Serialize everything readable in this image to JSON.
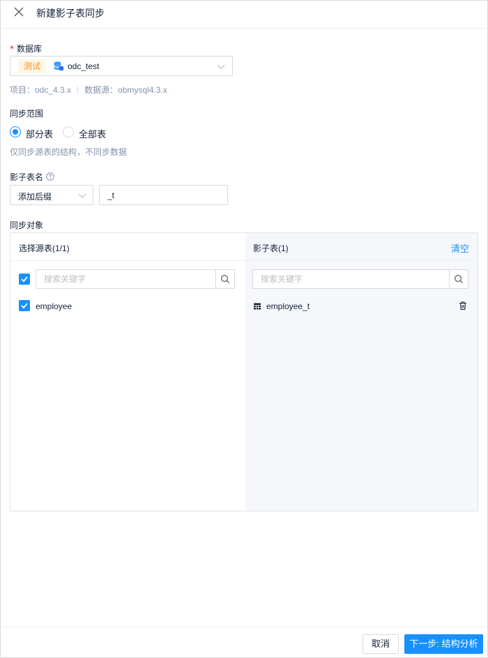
{
  "header": {
    "title": "新建影子表同步",
    "close_icon": "close-icon"
  },
  "database": {
    "required_mark": "*",
    "label": "数据库",
    "env_tag": "测试",
    "db_name": "odc_test",
    "project_text": "项目：odc_4.3.x",
    "datasource_text": "数据源：obmysql4.3.x"
  },
  "sync_scope": {
    "label": "同步范围",
    "options": [
      {
        "label": "部分表",
        "checked": true
      },
      {
        "label": "全部表",
        "checked": false
      }
    ],
    "help": "仅同步源表的结构，不同步数据"
  },
  "shadow_name": {
    "label": "影子表名",
    "mode_value": "添加后缀",
    "suffix_value": "_t"
  },
  "sync_objects": {
    "label": "同步对象",
    "source": {
      "title": "选择源表(1/1)",
      "search_placeholder": "搜索关键字",
      "items": [
        {
          "name": "employee",
          "checked": true
        }
      ]
    },
    "target": {
      "title": "影子表(1)",
      "clear_label": "清空",
      "search_placeholder": "搜索关键字",
      "items": [
        {
          "name": "employee_t"
        }
      ]
    }
  },
  "footer": {
    "cancel_label": "取消",
    "next_label": "下一步: 结构分析"
  },
  "colors": {
    "primary": "#1890ff",
    "env_tag": "#fa8c16",
    "env_tag_bg": "#fff7e6",
    "required": "#f5222d",
    "muted": "#8592ad",
    "panel_bg": "#f5f7fa"
  }
}
